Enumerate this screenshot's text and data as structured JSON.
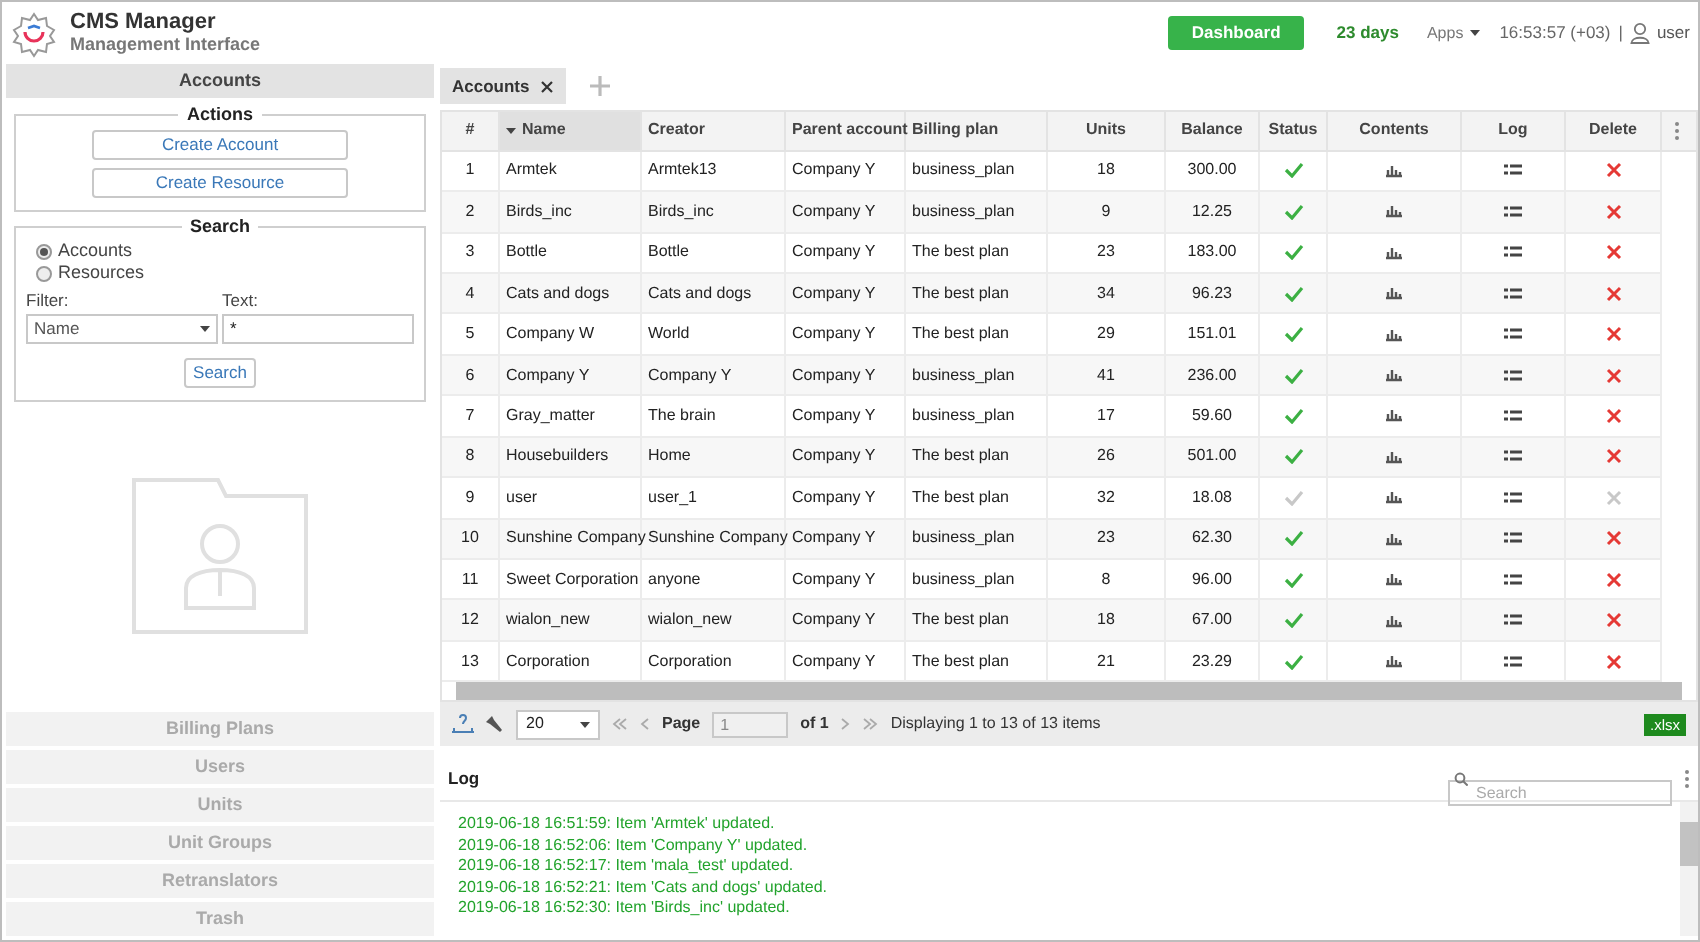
{
  "header": {
    "title": "CMS Manager",
    "subtitle": "Management Interface",
    "dashboard": "Dashboard",
    "days": "23 days",
    "apps": "Apps",
    "time": "16:53:57 (+03)",
    "separator": "|",
    "user": "user"
  },
  "sidebar": {
    "title": "Accounts",
    "actions": {
      "legend": "Actions",
      "buttons": [
        "Create Account",
        "Create Resource"
      ]
    },
    "search": {
      "legend": "Search",
      "radios": [
        {
          "label": "Accounts",
          "selected": true
        },
        {
          "label": "Resources",
          "selected": false
        }
      ],
      "filter_label": "Filter:",
      "filter_value": "Name",
      "text_label": "Text:",
      "text_value": "*",
      "button": "Search"
    },
    "nav": [
      "Billing Plans",
      "Users",
      "Units",
      "Unit Groups",
      "Retranslators",
      "Trash"
    ]
  },
  "tabs": [
    {
      "label": "Accounts",
      "selected": true
    }
  ],
  "table": {
    "columns": [
      {
        "label": "#",
        "sorted": false
      },
      {
        "label": "Name",
        "sorted": true
      },
      {
        "label": "Creator",
        "sorted": false
      },
      {
        "label": "Parent account",
        "sorted": false
      },
      {
        "label": "Billing plan",
        "sorted": false
      },
      {
        "label": "Units",
        "sorted": false
      },
      {
        "label": "Balance",
        "sorted": false
      },
      {
        "label": "Status",
        "sorted": false
      },
      {
        "label": "Contents",
        "sorted": false
      },
      {
        "label": "Log",
        "sorted": false
      },
      {
        "label": "Delete",
        "sorted": false
      }
    ],
    "rows": [
      {
        "cells": [
          "1",
          "Armtek",
          "Armtek13",
          "Company Y",
          "business_plan",
          "18",
          "300.00"
        ],
        "active": true
      },
      {
        "cells": [
          "2",
          "Birds_inc",
          "Birds_inc",
          "Company Y",
          "business_plan",
          "9",
          "12.25"
        ],
        "active": true
      },
      {
        "cells": [
          "3",
          "Bottle",
          "Bottle",
          "Company Y",
          "The best plan",
          "23",
          "183.00"
        ],
        "active": true
      },
      {
        "cells": [
          "4",
          "Cats and dogs",
          "Cats and dogs",
          "Company Y",
          "The best plan",
          "34",
          "96.23"
        ],
        "active": true
      },
      {
        "cells": [
          "5",
          "Company W",
          "World",
          "Company Y",
          "The best plan",
          "29",
          "151.01"
        ],
        "active": true
      },
      {
        "cells": [
          "6",
          "Company Y",
          "Company Y",
          "Company Y",
          "business_plan",
          "41",
          "236.00"
        ],
        "active": true
      },
      {
        "cells": [
          "7",
          "Gray_matter",
          "The brain",
          "Company Y",
          "business_plan",
          "17",
          "59.60"
        ],
        "active": true
      },
      {
        "cells": [
          "8",
          "Housebuilders",
          "Home",
          "Company Y",
          "The best plan",
          "26",
          "501.00"
        ],
        "active": true
      },
      {
        "cells": [
          "9",
          "user",
          "user_1",
          "Company Y",
          "The best plan",
          "32",
          "18.08"
        ],
        "active": false
      },
      {
        "cells": [
          "10",
          "Sunshine Company",
          "Sunshine Company",
          "Company Y",
          "business_plan",
          "23",
          "62.30"
        ],
        "active": true
      },
      {
        "cells": [
          "11",
          "Sweet Corporation",
          "anyone",
          "Company Y",
          "business_plan",
          "8",
          "96.00"
        ],
        "active": true
      },
      {
        "cells": [
          "12",
          "wialon_new",
          "wialon_new",
          "Company Y",
          "The best plan",
          "18",
          "67.00"
        ],
        "active": true
      },
      {
        "cells": [
          "13",
          "Corporation",
          "Corporation",
          "Company Y",
          "The best plan",
          "21",
          "23.29"
        ],
        "active": true
      }
    ]
  },
  "pager": {
    "page_size": "20",
    "page_label": "Page",
    "page_value": "1",
    "of": "of 1",
    "displaying": "Displaying 1 to 13 of 13 items",
    "export": ".xlsx"
  },
  "log": {
    "title": "Log",
    "search_placeholder": "Search",
    "entries": [
      "2019-06-18 16:51:59: Item 'Armtek' updated.",
      "2019-06-18 16:52:06: Item 'Company Y' updated.",
      "2019-06-18 16:52:17: Item 'mala_test' updated.",
      "2019-06-18 16:52:21: Item 'Cats and dogs' updated.",
      "2019-06-18 16:52:30: Item 'Birds_inc' updated."
    ]
  }
}
